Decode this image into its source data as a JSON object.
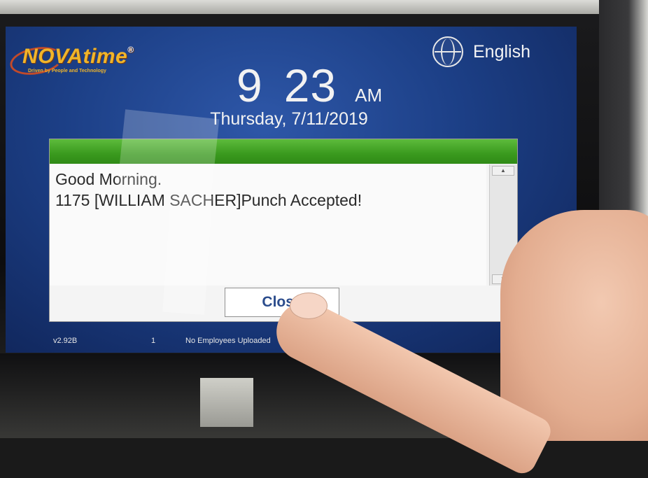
{
  "branding": {
    "logo_text": "NOVAtime",
    "logo_mark": "®",
    "tagline": "Driven by People and Technology"
  },
  "language": {
    "label": "English",
    "icon": "globe-icon"
  },
  "clock": {
    "hour": "9",
    "minute": "23",
    "ampm": "AM",
    "date": "Thursday, 7/11/2019"
  },
  "dialog": {
    "greeting": "Good Morning.",
    "employee_id": "1175",
    "employee_name": "[WILLIAM SACHER]",
    "status": "Punch Accepted!",
    "close_label": "Close",
    "header_color": "#3a9a1e"
  },
  "status_bar": {
    "version": "v2.92B",
    "count": "1",
    "message": "No Employees Uploaded"
  }
}
